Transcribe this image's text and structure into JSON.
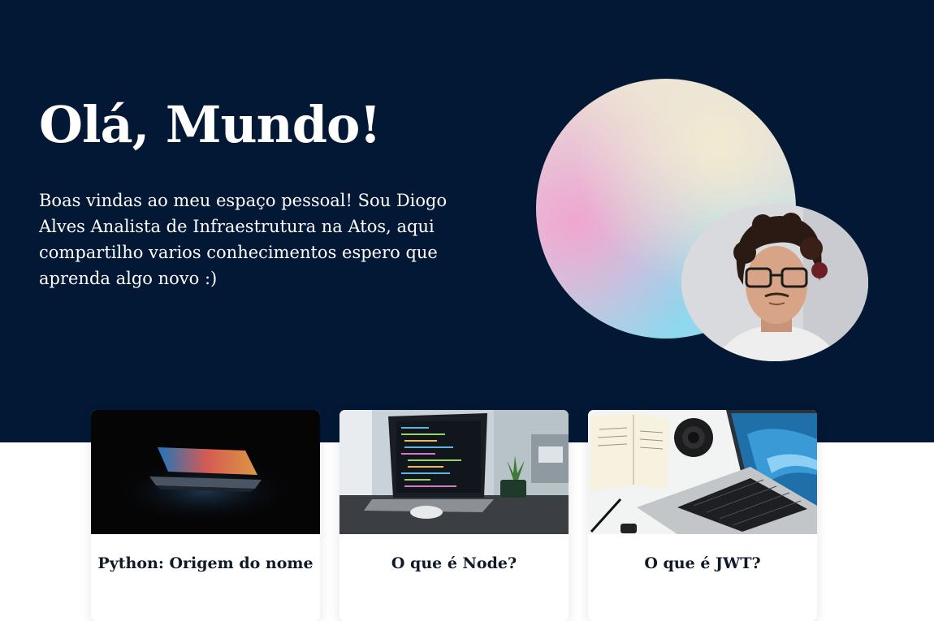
{
  "hero": {
    "title": "Olá, Mundo!",
    "description": "Boas vindas ao meu espaço pessoal! Sou Diogo Alves Analista de Infraestrutura na Atos, aqui compartilho varios conhecimentos espero que aprenda algo novo :)"
  },
  "colors": {
    "hero_background": "#031835",
    "card_background": "#ffffff",
    "text_dark": "#111827"
  },
  "posts": [
    {
      "title": "Python: Origem do nome",
      "image": "laptop-dark-glow-photo"
    },
    {
      "title": "O que é Node?",
      "image": "laptop-code-desk-photo"
    },
    {
      "title": "O que é JWT?",
      "image": "laptop-desk-top-view-photo"
    }
  ]
}
